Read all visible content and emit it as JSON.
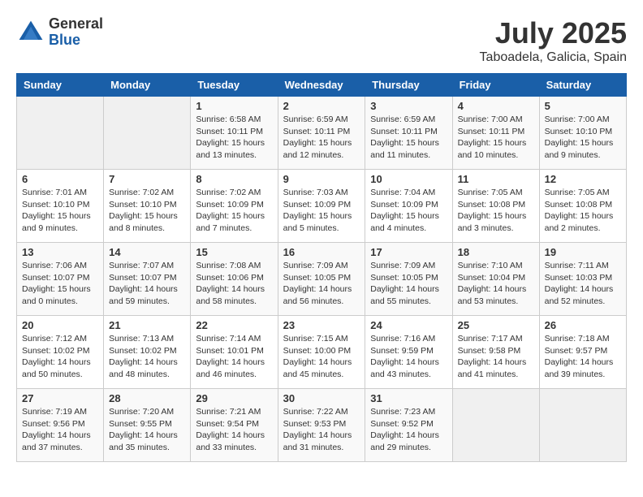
{
  "header": {
    "logo_general": "General",
    "logo_blue": "Blue",
    "title": "July 2025",
    "subtitle": "Taboadela, Galicia, Spain"
  },
  "weekdays": [
    "Sunday",
    "Monday",
    "Tuesday",
    "Wednesday",
    "Thursday",
    "Friday",
    "Saturday"
  ],
  "weeks": [
    [
      {
        "day": "",
        "info": ""
      },
      {
        "day": "",
        "info": ""
      },
      {
        "day": "1",
        "info": "Sunrise: 6:58 AM\nSunset: 10:11 PM\nDaylight: 15 hours\nand 13 minutes."
      },
      {
        "day": "2",
        "info": "Sunrise: 6:59 AM\nSunset: 10:11 PM\nDaylight: 15 hours\nand 12 minutes."
      },
      {
        "day": "3",
        "info": "Sunrise: 6:59 AM\nSunset: 10:11 PM\nDaylight: 15 hours\nand 11 minutes."
      },
      {
        "day": "4",
        "info": "Sunrise: 7:00 AM\nSunset: 10:11 PM\nDaylight: 15 hours\nand 10 minutes."
      },
      {
        "day": "5",
        "info": "Sunrise: 7:00 AM\nSunset: 10:10 PM\nDaylight: 15 hours\nand 9 minutes."
      }
    ],
    [
      {
        "day": "6",
        "info": "Sunrise: 7:01 AM\nSunset: 10:10 PM\nDaylight: 15 hours\nand 9 minutes."
      },
      {
        "day": "7",
        "info": "Sunrise: 7:02 AM\nSunset: 10:10 PM\nDaylight: 15 hours\nand 8 minutes."
      },
      {
        "day": "8",
        "info": "Sunrise: 7:02 AM\nSunset: 10:09 PM\nDaylight: 15 hours\nand 7 minutes."
      },
      {
        "day": "9",
        "info": "Sunrise: 7:03 AM\nSunset: 10:09 PM\nDaylight: 15 hours\nand 5 minutes."
      },
      {
        "day": "10",
        "info": "Sunrise: 7:04 AM\nSunset: 10:09 PM\nDaylight: 15 hours\nand 4 minutes."
      },
      {
        "day": "11",
        "info": "Sunrise: 7:05 AM\nSunset: 10:08 PM\nDaylight: 15 hours\nand 3 minutes."
      },
      {
        "day": "12",
        "info": "Sunrise: 7:05 AM\nSunset: 10:08 PM\nDaylight: 15 hours\nand 2 minutes."
      }
    ],
    [
      {
        "day": "13",
        "info": "Sunrise: 7:06 AM\nSunset: 10:07 PM\nDaylight: 15 hours\nand 0 minutes."
      },
      {
        "day": "14",
        "info": "Sunrise: 7:07 AM\nSunset: 10:07 PM\nDaylight: 14 hours\nand 59 minutes."
      },
      {
        "day": "15",
        "info": "Sunrise: 7:08 AM\nSunset: 10:06 PM\nDaylight: 14 hours\nand 58 minutes."
      },
      {
        "day": "16",
        "info": "Sunrise: 7:09 AM\nSunset: 10:05 PM\nDaylight: 14 hours\nand 56 minutes."
      },
      {
        "day": "17",
        "info": "Sunrise: 7:09 AM\nSunset: 10:05 PM\nDaylight: 14 hours\nand 55 minutes."
      },
      {
        "day": "18",
        "info": "Sunrise: 7:10 AM\nSunset: 10:04 PM\nDaylight: 14 hours\nand 53 minutes."
      },
      {
        "day": "19",
        "info": "Sunrise: 7:11 AM\nSunset: 10:03 PM\nDaylight: 14 hours\nand 52 minutes."
      }
    ],
    [
      {
        "day": "20",
        "info": "Sunrise: 7:12 AM\nSunset: 10:02 PM\nDaylight: 14 hours\nand 50 minutes."
      },
      {
        "day": "21",
        "info": "Sunrise: 7:13 AM\nSunset: 10:02 PM\nDaylight: 14 hours\nand 48 minutes."
      },
      {
        "day": "22",
        "info": "Sunrise: 7:14 AM\nSunset: 10:01 PM\nDaylight: 14 hours\nand 46 minutes."
      },
      {
        "day": "23",
        "info": "Sunrise: 7:15 AM\nSunset: 10:00 PM\nDaylight: 14 hours\nand 45 minutes."
      },
      {
        "day": "24",
        "info": "Sunrise: 7:16 AM\nSunset: 9:59 PM\nDaylight: 14 hours\nand 43 minutes."
      },
      {
        "day": "25",
        "info": "Sunrise: 7:17 AM\nSunset: 9:58 PM\nDaylight: 14 hours\nand 41 minutes."
      },
      {
        "day": "26",
        "info": "Sunrise: 7:18 AM\nSunset: 9:57 PM\nDaylight: 14 hours\nand 39 minutes."
      }
    ],
    [
      {
        "day": "27",
        "info": "Sunrise: 7:19 AM\nSunset: 9:56 PM\nDaylight: 14 hours\nand 37 minutes."
      },
      {
        "day": "28",
        "info": "Sunrise: 7:20 AM\nSunset: 9:55 PM\nDaylight: 14 hours\nand 35 minutes."
      },
      {
        "day": "29",
        "info": "Sunrise: 7:21 AM\nSunset: 9:54 PM\nDaylight: 14 hours\nand 33 minutes."
      },
      {
        "day": "30",
        "info": "Sunrise: 7:22 AM\nSunset: 9:53 PM\nDaylight: 14 hours\nand 31 minutes."
      },
      {
        "day": "31",
        "info": "Sunrise: 7:23 AM\nSunset: 9:52 PM\nDaylight: 14 hours\nand 29 minutes."
      },
      {
        "day": "",
        "info": ""
      },
      {
        "day": "",
        "info": ""
      }
    ]
  ]
}
